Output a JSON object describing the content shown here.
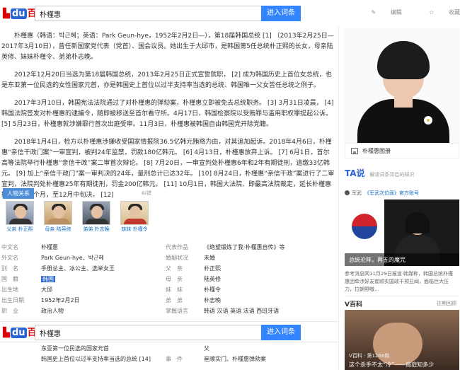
{
  "top": {
    "logo_text": "百科",
    "logo_du": "du",
    "search_value": "朴槿惠",
    "search_button": "进入词条",
    "edit_label": "编辑",
    "collect_label": "收藏"
  },
  "paragraphs": [
    "朴槿惠（韩语：박근혜；英语：Park Geun-hye，1952年2月2日—），第18届韩国总统 [1] （2013年2月25日—2017年3月10日），曾任新国家党代表（党首）、国会议员。她出生于大邱市，是韩国第5任总统朴正熙的长女，母亲陆英修、妹妹朴槿令、弟弟朴志晚。",
    "2012年12月20日当选为第18届韩国总统，2013年2月25日正式宣誓就职， [2] 成为韩国历史上首位女总统，也是东亚第一位民选的女性国家元首，亦是韩国史上首位以过半支持率当选的总统、韩国唯一父女皆任总统之例子。",
    "2017年3月10日，韩国宪法法院通过了对朴槿惠的弹劾案，朴槿惠立即被免去总统职务。 [3] 3月31日凌晨， [4] 韩国法院签发对朴槿惠的逮捕令，随即被移送至首尔看守所。4月17日，韩国检察院以受贿罪与滥用职权罪提起公诉。 [5] 5月23日，朴槿惠就涉嫌罪行首次出庭受审。11月3日，朴槿惠被韩国自由韩国党开除党籍。",
    "2018年1月4日，检方以朴槿惠涉嫌收受国家情报院36.5亿韩元贿赂为由，对其追加起诉。2018年4月6日，朴槿惠“亲信干政门案”一审宣判，被判24年监禁，罚款180亿韩元。 [6] 4月13日，朴槿惠放弃上诉。 [7] 6月1日，首尔高等法院举行朴槿惠“亲信干政”案二审首次辩论。 [8] 7月20日，一审宣判处朴槿惠6年和2年有期徒刑，追缴33亿韩元。 [9] 加上“亲信干政门”案一审判决的24年，量刑总计已达32年。 [10] 8月24日，朴槿惠“亲信干政”案进行了二审宣判，法院判处朴槿惠25年有期徒刑，罚金200亿韩元。 [11] 10月1日，韩国大法院、即最高法院裁定，延长朴槿惠拘留期限两个月，至12月中旬决。 [12]"
  ],
  "relations": {
    "tab": "人物关系",
    "corr": "纠错",
    "items": [
      {
        "label": "父亲 朴正熙"
      },
      {
        "label": "母亲 陆英修"
      },
      {
        "label": "弟弟 朴志晚"
      },
      {
        "label": "妹妹 朴槿令"
      }
    ]
  },
  "basic_info": [
    {
      "k1": "中文名",
      "v1": "朴槿惠",
      "k2": "代表作品",
      "v2": "《绝望锻炼了我·朴槿惠自传》等"
    },
    {
      "k1": "外文名",
      "v1": "Park Geun-hye、박근혜",
      "k2": "婚姻状况",
      "v2": "未婚"
    },
    {
      "k1": "别　名",
      "v1": "手册总主、冰公主、选举女王",
      "k2": "父　亲",
      "v2": "朴正熙"
    },
    {
      "k1": "国　籍",
      "v1": "韩国",
      "k2": "母　亲",
      "v2": "陆英修"
    },
    {
      "k1": "出生地",
      "v1": "大邱",
      "k2": "妹　妹",
      "v2": "朴槿令"
    },
    {
      "k1": "出生日期",
      "v1": "1952年2月2日",
      "k2": "弟　弟",
      "v2": "朴志晚"
    },
    {
      "k1": "职　业",
      "v1": "政治人物",
      "k2": "掌握语言",
      "v2": "韩语 汉语 英语 法语 西班牙语"
    }
  ],
  "basic_info2": [
    {
      "k1": "",
      "v1": "东亚第一位民选的国家元首",
      "k2": "",
      "v2": "父"
    },
    {
      "k1": "",
      "v1": "韩国史上首位以过半支持率当选的总统 [14]",
      "k2": "事　件",
      "v2": "崔顺实门、朴槿惠弹劾案"
    }
  ],
  "side": {
    "album_label": "朴槿惠图册",
    "ta_logo": "TA说",
    "ta_sub": "解读词条背后的知识",
    "ta_source": "军武",
    "ta_tag": "《军武次位面》官方账号",
    "ta_caption": "总统沦阵，再五的魔咒",
    "ta_text": "参考消息网11月29日报道 韩媒称，韩国总统朴槿惠因牵涉好友崔顺实国政干预丑闻，面临巨大压力，拉朝野嗷...",
    "vbaike_logo": "V百科",
    "vbaike_link": "往期回顾",
    "vbaike_meta": "V百科 · 第1268期",
    "vbaike_caption": "这个杀手不太“冷”——癌症知多少"
  }
}
